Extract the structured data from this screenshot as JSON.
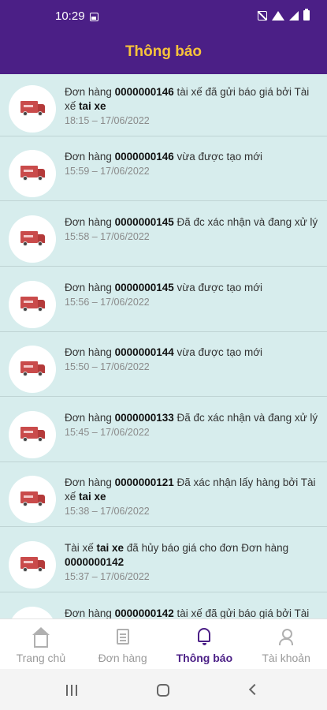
{
  "status_bar": {
    "time": "10:29",
    "icons": [
      "gallery-icon",
      "mute-icon",
      "wifi-icon",
      "signal-icon",
      "battery-icon"
    ]
  },
  "header": {
    "title": "Thông báo"
  },
  "colors": {
    "brand": "#4b1f86",
    "title": "#f7c33a",
    "list_bg": "#d7eded"
  },
  "notifications": [
    {
      "parts": [
        "Đơn hàng ",
        "0000000146",
        " tài xế đã gửi báo giá bởi Tài xế ",
        "tai xe",
        ""
      ],
      "time": "18:15 – 17/06/2022"
    },
    {
      "parts": [
        "Đơn hàng ",
        "0000000146",
        " vừa được tạo mới",
        "",
        ""
      ],
      "time": "15:59 – 17/06/2022"
    },
    {
      "parts": [
        "Đơn hàng ",
        "0000000145",
        " Đã đc xác nhận và đang xử lý",
        "",
        ""
      ],
      "time": "15:58 – 17/06/2022"
    },
    {
      "parts": [
        "Đơn hàng ",
        "0000000145",
        " vừa được tạo mới",
        "",
        ""
      ],
      "time": "15:56 – 17/06/2022"
    },
    {
      "parts": [
        "Đơn hàng ",
        "0000000144",
        " vừa được tạo mới",
        "",
        ""
      ],
      "time": "15:50 – 17/06/2022"
    },
    {
      "parts": [
        "Đơn hàng ",
        "0000000133",
        " Đã đc xác nhận và đang xử lý",
        "",
        ""
      ],
      "time": "15:45 – 17/06/2022"
    },
    {
      "parts": [
        "Đơn hàng ",
        "0000000121",
        " Đã xác nhận lấy hàng bởi Tài xế ",
        "tai xe",
        ""
      ],
      "time": "15:38 – 17/06/2022"
    },
    {
      "parts": [
        "Tài xế ",
        "tai xe",
        " đã hủy báo giá cho đơn Đơn hàng ",
        "0000000142",
        ""
      ],
      "time": "15:37 – 17/06/2022"
    },
    {
      "parts": [
        "Đơn hàng ",
        "0000000142",
        " tài xế đã gửi báo giá bởi Tài xế",
        "",
        ""
      ],
      "time": ""
    }
  ],
  "tabs": [
    {
      "label": "Trang chủ",
      "icon": "home-icon"
    },
    {
      "label": "Đơn hàng",
      "icon": "orders-icon"
    },
    {
      "label": "Thông báo",
      "icon": "bell-icon"
    },
    {
      "label": "Tài khoản",
      "icon": "user-icon"
    }
  ]
}
